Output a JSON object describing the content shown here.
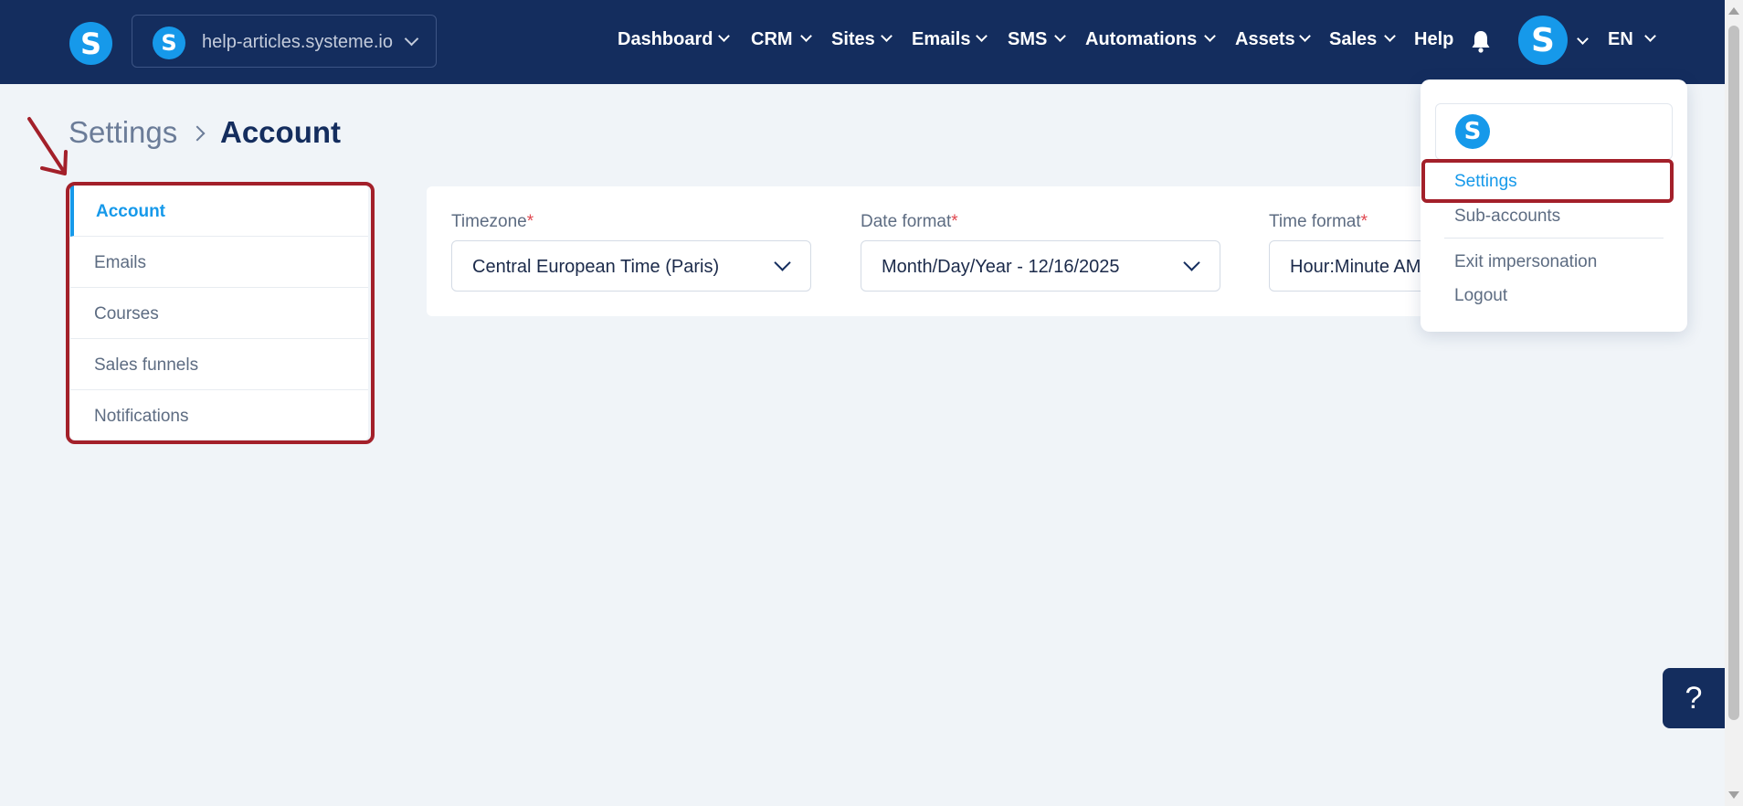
{
  "header": {
    "site_switcher": {
      "logo_letter": "S",
      "domain": "help-articles.systeme.io"
    },
    "nav": [
      {
        "label": "Dashboard",
        "has_dropdown": true
      },
      {
        "label": "CRM",
        "has_dropdown": true
      },
      {
        "label": "Sites",
        "has_dropdown": true
      },
      {
        "label": "Emails",
        "has_dropdown": true
      },
      {
        "label": "SMS",
        "has_dropdown": true
      },
      {
        "label": "Automations",
        "has_dropdown": true
      },
      {
        "label": "Assets",
        "has_dropdown": true
      },
      {
        "label": "Sales",
        "has_dropdown": true
      },
      {
        "label": "Help",
        "has_dropdown": false
      }
    ],
    "avatar_letter": "S",
    "language": "EN"
  },
  "breadcrumb": {
    "parent": "Settings",
    "current": "Account"
  },
  "sidebar": {
    "items": [
      {
        "label": "Account",
        "active": true
      },
      {
        "label": "Emails",
        "active": false
      },
      {
        "label": "Courses",
        "active": false
      },
      {
        "label": "Sales funnels",
        "active": false
      },
      {
        "label": "Notifications",
        "active": false
      }
    ]
  },
  "form": {
    "timezone": {
      "label": "Timezone",
      "required_mark": "*",
      "value": "Central European Time (Paris)"
    },
    "date_format": {
      "label": "Date format",
      "required_mark": "*",
      "value": "Month/Day/Year - 12/16/2025"
    },
    "time_format": {
      "label": "Time format",
      "required_mark": "*",
      "value": "Hour:Minute AM/PM"
    }
  },
  "user_menu": {
    "logo_letter": "S",
    "items": [
      {
        "label": "Settings"
      },
      {
        "label": "Sub-accounts"
      },
      {
        "label": "Exit impersonation"
      },
      {
        "label": "Logout"
      }
    ]
  },
  "help_button": {
    "label": "?"
  },
  "colors": {
    "header_bg": "#142d5e",
    "brand_blue": "#1699ea",
    "annotation_red": "#a3202a",
    "page_bg": "#f0f4f8"
  }
}
